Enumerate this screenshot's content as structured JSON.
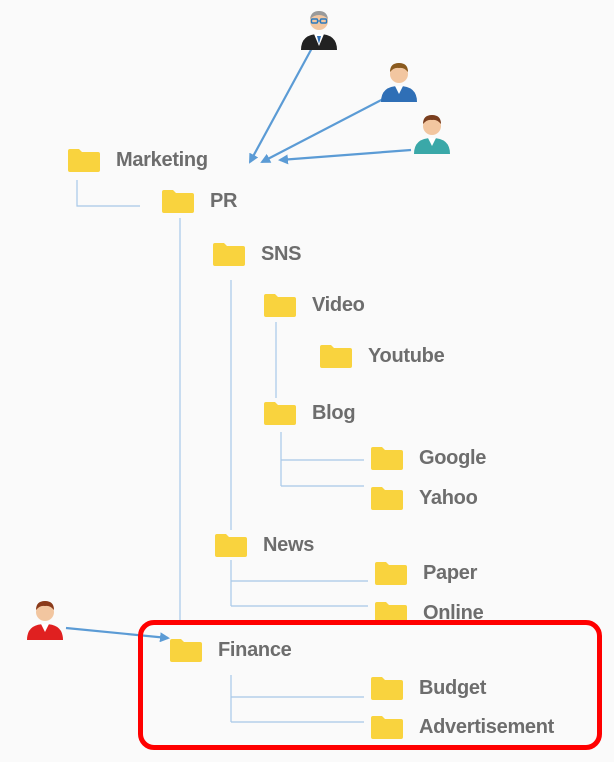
{
  "folders": {
    "marketing": "Marketing",
    "pr": "PR",
    "sns": "SNS",
    "video": "Video",
    "youtube": "Youtube",
    "blog": "Blog",
    "google": "Google",
    "yahoo": "Yahoo",
    "news": "News",
    "paper": "Paper",
    "online": "Online",
    "finance": "Finance",
    "budget": "Budget",
    "advertisement": "Advertisement"
  },
  "icons": {
    "folder": "folder-icon",
    "user": "user-avatar-icon",
    "arrow": "arrow"
  },
  "colors": {
    "folder": "#f9d33e",
    "label": "#6d6d6d",
    "connector": "#a7c8e8",
    "arrow": "#5b9bd5",
    "highlight": "#ff0000",
    "avatar_glasses_shirt": "#222222",
    "avatar_blue_shirt": "#2f6fb6",
    "avatar_teal_shirt": "#3aa8a8",
    "avatar_red_shirt": "#e02020"
  }
}
